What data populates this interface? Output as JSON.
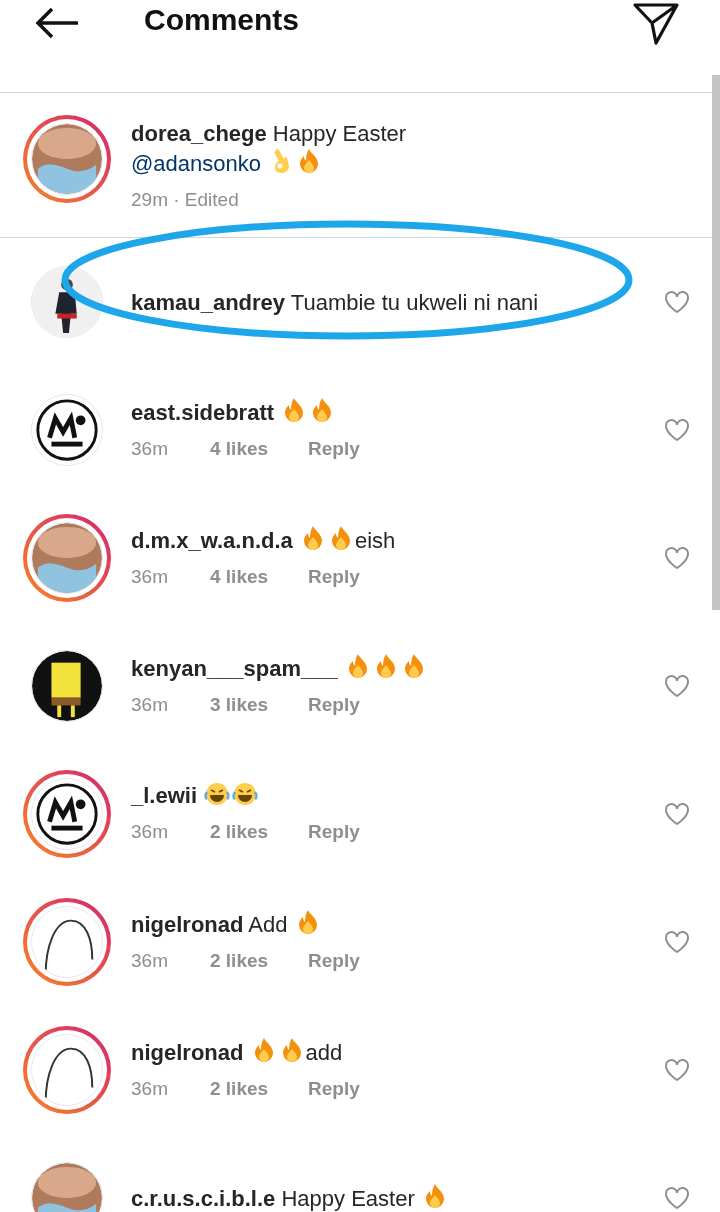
{
  "header": {
    "title": "Comments"
  },
  "caption": {
    "user": "dorea_chege",
    "story_ring": true,
    "parts": [
      {
        "kind": "text",
        "text": "Happy Easter"
      },
      {
        "kind": "break"
      },
      {
        "kind": "mention",
        "text": "@adansonko"
      },
      {
        "kind": "ok"
      },
      {
        "kind": "fire"
      }
    ],
    "time": "29m · Edited"
  },
  "comments": [
    {
      "user": "kamau_andrey",
      "story_ring": false,
      "parts": [
        {
          "kind": "text",
          "text": "Tuambie tu ukweli ni nani"
        }
      ],
      "highlighted": true
    },
    {
      "user": "east.sidebratt",
      "story_ring": false,
      "parts": [
        {
          "kind": "fire"
        },
        {
          "kind": "fire"
        }
      ],
      "time": "36m",
      "likes": "4 likes",
      "reply": "Reply",
      "highlighted": false
    },
    {
      "user": "d.m.x_w.a.n.d.a",
      "story_ring": true,
      "parts": [
        {
          "kind": "fire"
        },
        {
          "kind": "fire"
        },
        {
          "kind": "text",
          "text": "eish"
        }
      ],
      "time": "36m",
      "likes": "4 likes",
      "reply": "Reply",
      "highlighted": false
    },
    {
      "user": "kenyan___spam___",
      "story_ring": false,
      "parts": [
        {
          "kind": "fire"
        },
        {
          "kind": "fire"
        },
        {
          "kind": "fire"
        }
      ],
      "time": "36m",
      "likes": "3 likes",
      "reply": "Reply",
      "highlighted": false
    },
    {
      "user": "_l.ewii",
      "story_ring": true,
      "parts": [
        {
          "kind": "laugh"
        },
        {
          "kind": "laugh"
        }
      ],
      "time": "36m",
      "likes": "2 likes",
      "reply": "Reply",
      "highlighted": false
    },
    {
      "user": "nigelronad",
      "story_ring": true,
      "parts": [
        {
          "kind": "text",
          "text": "Add"
        },
        {
          "kind": "fire"
        }
      ],
      "time": "36m",
      "likes": "2 likes",
      "reply": "Reply",
      "highlighted": false
    },
    {
      "user": "nigelronad",
      "story_ring": true,
      "parts": [
        {
          "kind": "fire"
        },
        {
          "kind": "fire"
        },
        {
          "kind": "text",
          "text": "add"
        }
      ],
      "time": "36m",
      "likes": "2 likes",
      "reply": "Reply",
      "highlighted": false
    },
    {
      "user": "c.r.u.s.c.i.b.l.e",
      "story_ring": false,
      "parts": [
        {
          "kind": "text",
          "text": "Happy Easter"
        },
        {
          "kind": "fire"
        }
      ],
      "highlighted": false
    }
  ]
}
